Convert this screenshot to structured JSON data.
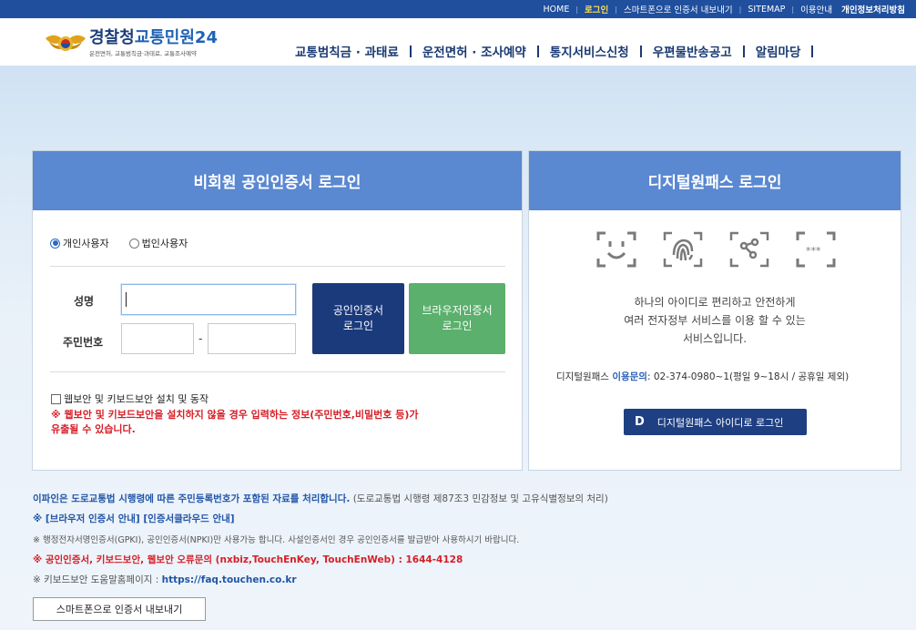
{
  "topbar": {
    "items": [
      "HOME",
      "로그인",
      "스마트폰으로 인증서 내보내기",
      "SITEMAP",
      "이용안내"
    ],
    "privacy": "개인정보처리방침"
  },
  "logo": {
    "title_a": "경찰청",
    "title_b": "교통민원24",
    "subtitle": "운전면허, 교통범칙금·과태료, 교통조사예약"
  },
  "nav": [
    "교통범칙금 · 과태료",
    "운전면허 · 조사예약",
    "통지서비스신청",
    "우편물반송공고",
    "알림마당"
  ],
  "left_panel": {
    "title": "비회원 공인인증서 로그인",
    "radio_personal": "개인사용자",
    "radio_corporate": "법인사용자",
    "name_label": "성명",
    "rrn_label": "주민번호",
    "rrn_dash": "-",
    "cert_button_line1": "공인인증서",
    "cert_button_line2": "로그인",
    "browser_button_line1": "브라우저인증서",
    "browser_button_line2": "로그인",
    "security_check": "웹보안 및 키보드보안 설치 및 동작",
    "warning_line1": "※ 웹보안 및 키보드보안을 설치하지 않을 경우 입력하는 정보(주민번호,비밀번호 등)가",
    "warning_line2": "유출될 수 있습니다."
  },
  "right_panel": {
    "title": "디지털원패스 로그인",
    "desc_line1": "하나의 아이디로 편리하고 안전하게",
    "desc_line2": "여러 전자정부 서비스를 이용 할 수 있는",
    "desc_line3": "서비스입니다.",
    "inquiry_prefix": "디지털원패스",
    "inquiry_label": "이용문의",
    "inquiry_text": ": 02-374-0980~1(평일 9~18시 / 공휴일 제외)",
    "login_button_icon": "D",
    "login_button": "디지털원패스 아이디로 로그인"
  },
  "notes": {
    "line1_bold": "이파인은 도로교통법 시행령에 따른 주민등록번호가 포함된 자료를 처리합니다.",
    "line1_rest": "(도로교통법 시행령 제87조3 민감정보 및 고유식별정보의 처리)",
    "line2": "※ [브라우저 인증서 안내] [인증서클라우드 안내]",
    "line3": "※ 행정전자서명인증서(GPKI), 공인인증서(NPKI)만 사용가능 합니다. 사설인증서인 경우 공인인증서를 발급받아 사용하시기 바랍니다.",
    "line4": "※ 공인인증서, 키보드보안, 웹보안 오류문의 (nxbiz,TouchEnKey, TouchEnWeb) : 1644-4128",
    "line5_prefix": "※ 키보드보안 도움말홈페이지 :",
    "line5_link": "https://faq.touchen.co.kr",
    "smart_button": "스마트폰으로 인증서 내보내기"
  }
}
